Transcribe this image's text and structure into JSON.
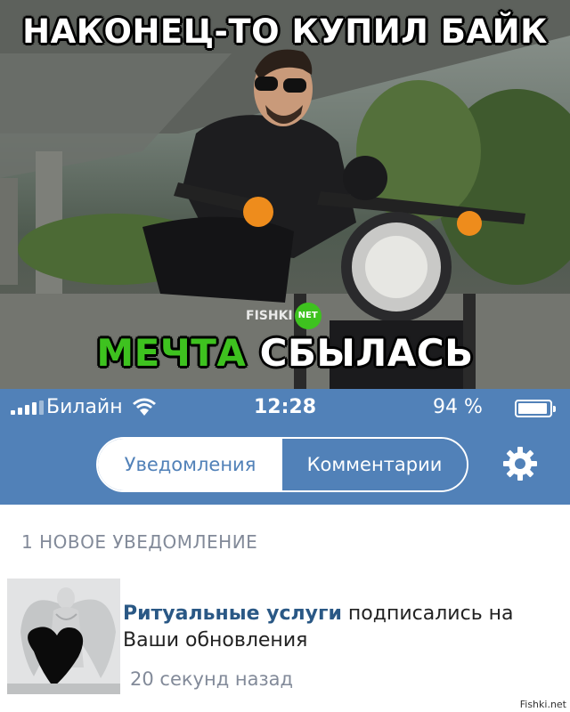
{
  "meme": {
    "top_caption": "НАКОНЕЦ-ТО КУПИЛ БАЙК",
    "bottom_caption_green": "МЕЧТА",
    "bottom_caption_white": "СБЫЛАСЬ",
    "watermark": "FISHKI",
    "watermark_badge": "NET"
  },
  "status_bar": {
    "carrier": "Билайн",
    "time": "12:28",
    "battery": "94 %",
    "battery_level": 0.94
  },
  "header": {
    "tabs": [
      {
        "label": "Уведомления",
        "active": true
      },
      {
        "label": "Комментарии",
        "active": false
      }
    ]
  },
  "notifications": {
    "section_title": "1 НОВОЕ УВЕДОМЛЕНИЕ",
    "items": [
      {
        "author": "Ритуальные услуги",
        "action": "подписались на Ваши обновления",
        "time": "20 секунд назад"
      }
    ]
  },
  "credit": "Fishki.net",
  "colors": {
    "vk_blue": "#5181b8",
    "link_blue": "#2a5885",
    "muted_gray": "#828a99",
    "meme_green": "#3ec21f"
  }
}
